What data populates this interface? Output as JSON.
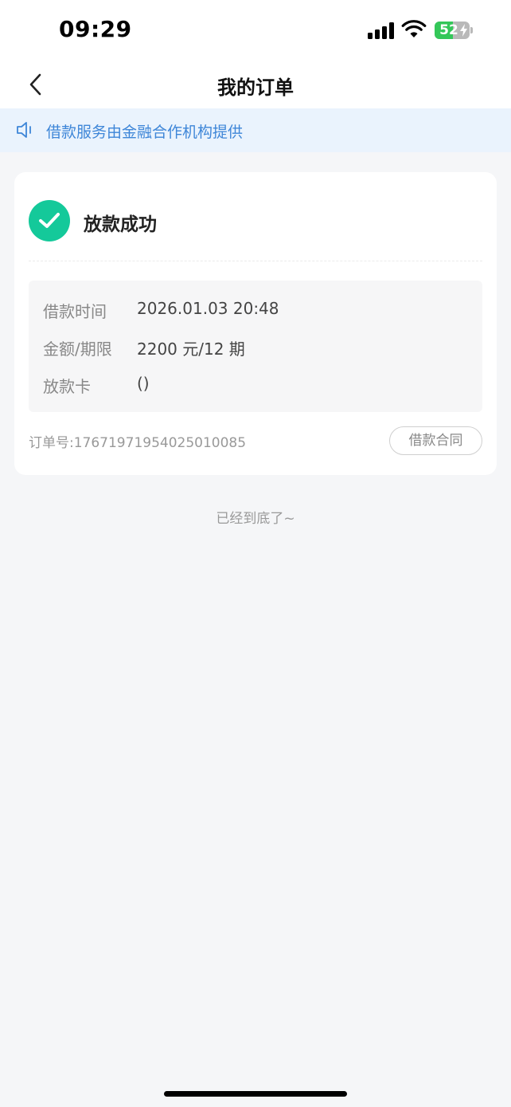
{
  "status_bar": {
    "time": "09:29",
    "battery_percent": "52",
    "battery_level": 0.52,
    "signal_icon": "cellular-signal-icon",
    "wifi_icon": "wifi-icon",
    "battery_icon": "battery-charging-icon"
  },
  "nav": {
    "title": "我的订单",
    "back_icon": "chevron-left-icon"
  },
  "notice": {
    "icon": "speaker-icon",
    "text": "借款服务由金融合作机构提供"
  },
  "order": {
    "status_icon": "check-circle-icon",
    "status": "放款成功",
    "details": [
      {
        "label": "借款时间",
        "value": "2026.01.03 20:48"
      },
      {
        "label": "金额/期限",
        "value": "2200 元/12 期"
      },
      {
        "label": "放款卡",
        "value": "()"
      }
    ],
    "order_number": "订单号:17671971954025010085",
    "contract_button": "借款合同"
  },
  "footer": {
    "end_text": "已经到底了~"
  },
  "colors": {
    "accent_blue": "#3e86d8",
    "notice_bg": "#eaf3fd",
    "success_green": "#14c99a",
    "page_bg": "#f5f6f8",
    "battery_green": "#34c759"
  }
}
